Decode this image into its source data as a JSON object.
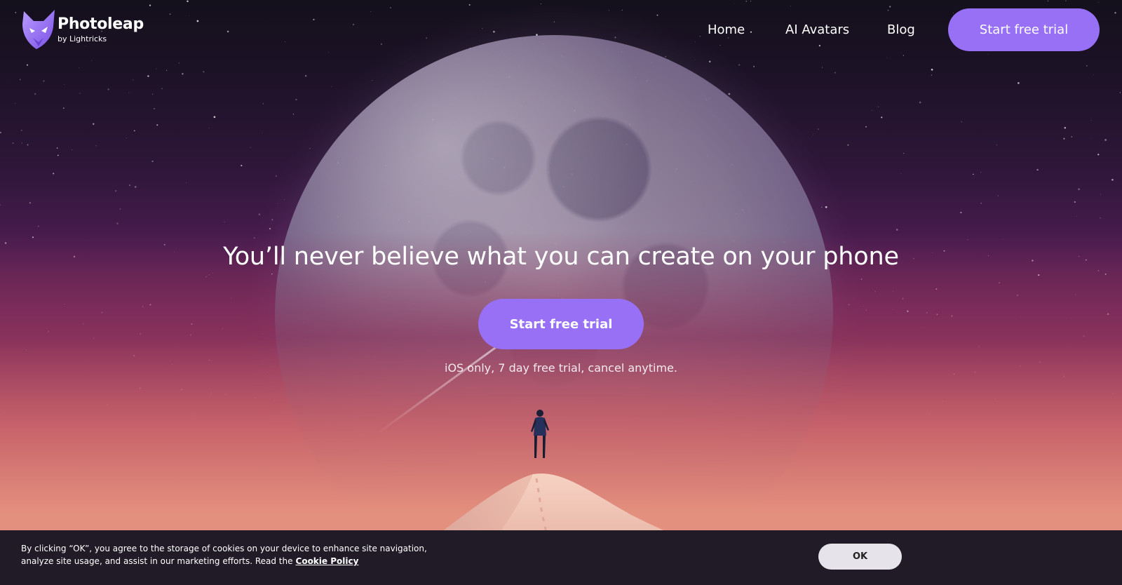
{
  "brand": {
    "name": "Photoleap",
    "byline": "by Lightricks",
    "logo_icon": "fox-head-icon",
    "accent_color": "#9870f5"
  },
  "nav": {
    "items": [
      {
        "label": "Home"
      },
      {
        "label": "AI Avatars"
      },
      {
        "label": "Blog"
      }
    ],
    "cta_label": "Start free trial"
  },
  "hero": {
    "title": "You’ll never believe what you can create on your phone",
    "cta_label": "Start free trial",
    "note": "iOS only, 7 day free trial, cancel anytime."
  },
  "cookie_banner": {
    "text": "By clicking “OK”, you agree to the storage of cookies on your device to enhance site navigation, analyze site usage, and assist in our marketing efforts. Read the",
    "link_label": "Cookie Policy",
    "ok_label": "OK",
    "background_color": "#201b27"
  }
}
